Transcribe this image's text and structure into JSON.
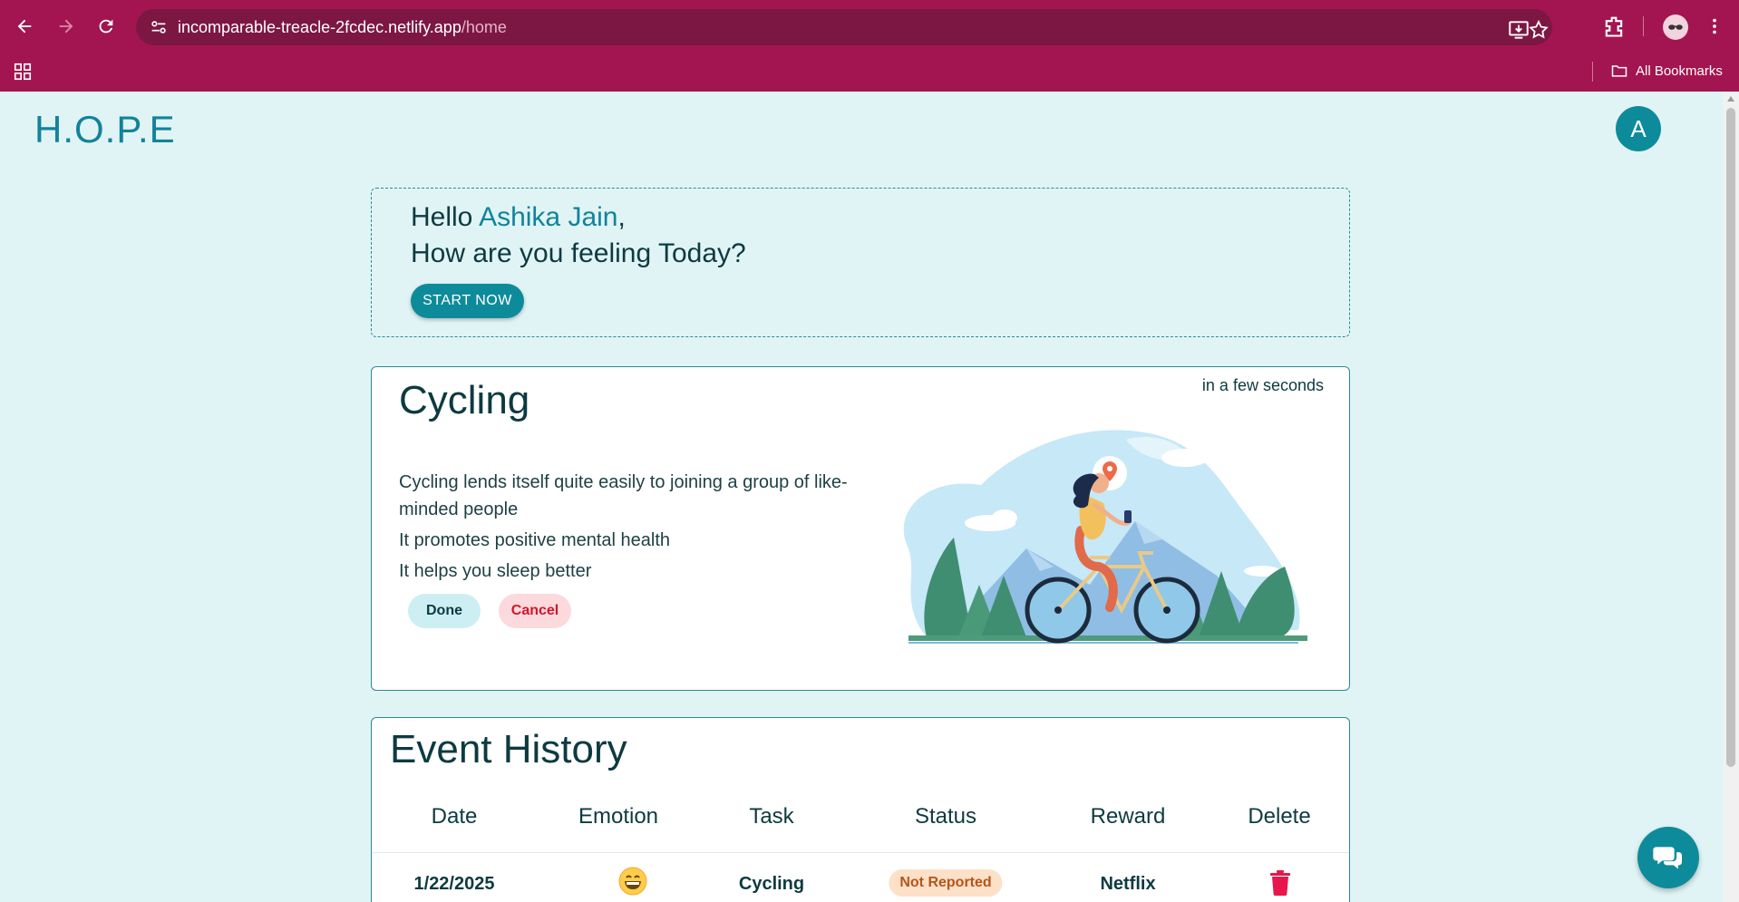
{
  "browser": {
    "url_host": "incomparable-treacle-2fcdec.netlify.app",
    "url_path": "/home",
    "bookmarks_label": "All Bookmarks"
  },
  "header": {
    "brand": "H.O.P.E",
    "avatar_initial": "A"
  },
  "greeting": {
    "hello": "Hello",
    "name": "Ashika Jain",
    "comma": ",",
    "question": "How are you feeling Today?",
    "start_label": "START NOW"
  },
  "task": {
    "title": "Cycling",
    "time": "in a few seconds",
    "benefits": [
      "Cycling lends itself quite easily to joining a group of like-minded people",
      "It promotes positive mental health",
      "It helps you sleep better"
    ],
    "done_label": "Done",
    "cancel_label": "Cancel"
  },
  "history": {
    "title": "Event History",
    "columns": [
      "Date",
      "Emotion",
      "Task",
      "Status",
      "Reward",
      "Delete"
    ],
    "rows": [
      {
        "date": "1/22/2025",
        "emotion": "grinning-face-icon",
        "task": "Cycling",
        "status": "Not Reported",
        "reward": "Netflix",
        "delete": "trash-icon"
      }
    ]
  },
  "colors": {
    "browser_frame": "#a31550",
    "page_bg": "#e0f4f6",
    "accent": "#0e8b9a",
    "delete_red": "#e8174b"
  }
}
